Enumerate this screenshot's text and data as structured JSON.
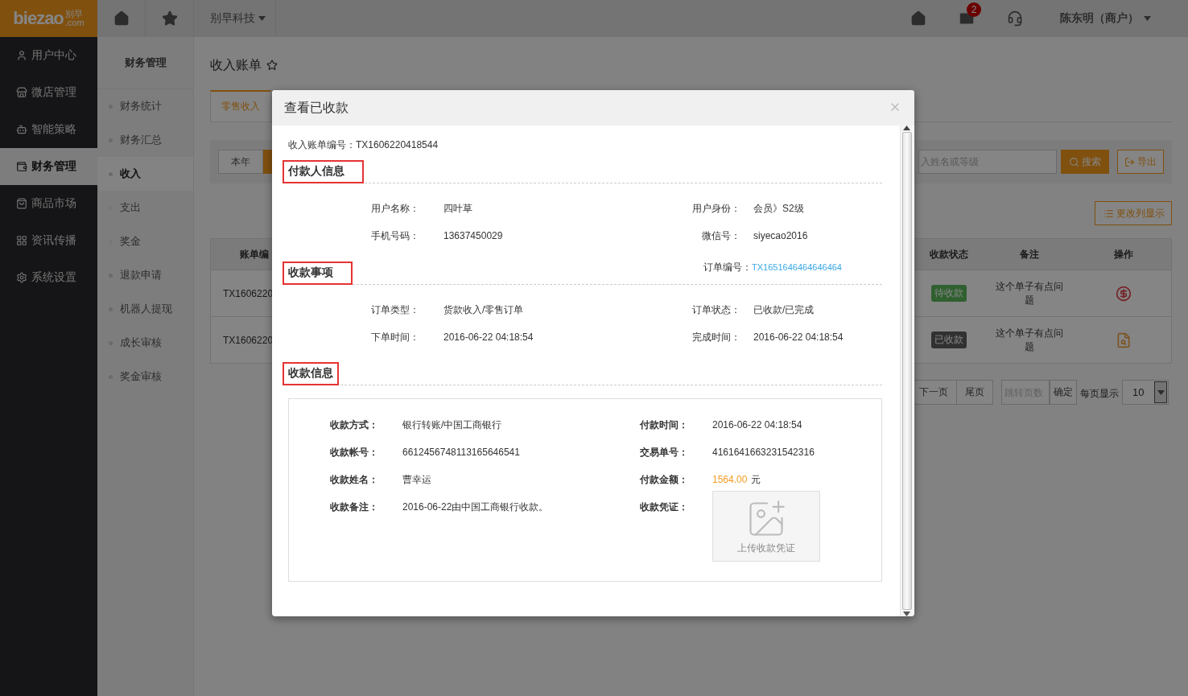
{
  "topbar": {
    "logo": {
      "word": "biezao",
      "cn": "别早",
      "domain": ".com"
    },
    "company": "别早科技",
    "mail_badge": "2",
    "user": "陈东明（商户）"
  },
  "sidebar": {
    "items": [
      {
        "label": "用户中心",
        "selected": false
      },
      {
        "label": "微店管理",
        "selected": false
      },
      {
        "label": "智能策略",
        "selected": false
      },
      {
        "label": "财务管理",
        "selected": true
      },
      {
        "label": "商品市场",
        "selected": false
      },
      {
        "label": "资讯传播",
        "selected": false
      },
      {
        "label": "系统设置",
        "selected": false
      }
    ]
  },
  "subnav": {
    "title": "财务管理",
    "items": [
      {
        "label": "财务统计",
        "kind": "dot",
        "selected": false
      },
      {
        "label": "财务汇总",
        "kind": "dot",
        "selected": false
      },
      {
        "label": "收入",
        "kind": "dot",
        "selected": true
      },
      {
        "label": "支出",
        "kind": "arrow",
        "selected": false
      },
      {
        "label": "奖金",
        "kind": "arrow",
        "selected": false
      },
      {
        "label": "退款申请",
        "kind": "dot",
        "selected": false
      },
      {
        "label": "机器人提现",
        "kind": "dot",
        "selected": false
      },
      {
        "label": "成长审核",
        "kind": "dot",
        "selected": false
      },
      {
        "label": "奖金审核",
        "kind": "dot",
        "selected": false
      }
    ]
  },
  "page": {
    "title": "收入账单",
    "tabs": [
      {
        "label": "零售收入",
        "selected": true
      }
    ],
    "filter": {
      "buttons": [
        {
          "label": "本年",
          "selected": false
        },
        {
          "selected": true
        }
      ],
      "search_placeholder": "入姓名或等级",
      "search_button": "搜索",
      "export_button": "导出"
    },
    "columns_button": "更改列显示",
    "table": {
      "columns": [
        "账单编",
        "收款状态",
        "备注",
        "操作"
      ],
      "rows": [
        {
          "bill": "TX1606220",
          "kind": "pending",
          "status": "待收款",
          "note": "这个单子有点问题"
        },
        {
          "bill": "TX1606220",
          "kind": "received",
          "status": "已收款",
          "note": "这个单子有点问题"
        }
      ]
    },
    "pagination": {
      "next": "下一页",
      "last": "尾页",
      "jump_placeholder": "跳转页数",
      "confirm": "确定",
      "per_page_label": "每页显示",
      "per_page": "10"
    }
  },
  "modal": {
    "title": "查看已收款",
    "bill_label": "收入账单编号：",
    "bill_no": "TX1606220418544",
    "payer": {
      "heading": "付款人信息",
      "fields": [
        {
          "label": "用户名称：",
          "value": "四叶草"
        },
        {
          "label": "用户身份：",
          "value": "会员》S2级"
        },
        {
          "label": "手机号码：",
          "value": "13637450029"
        },
        {
          "label": "微信号：",
          "value": "siyecao2016"
        }
      ]
    },
    "order": {
      "heading": "收款事项",
      "order_label": "订单编号：",
      "order_no": "TX1651646464646464",
      "fields": [
        {
          "label": "订单类型：",
          "value": "货款收入/零售订单"
        },
        {
          "label": "订单状态：",
          "value": "已收款/已完成"
        },
        {
          "label": "下单时间：",
          "value": "2016-06-22 04:18:54"
        },
        {
          "label": "完成时间：",
          "value": "2016-06-22 04:18:54"
        }
      ]
    },
    "receipt": {
      "heading": "收款信息",
      "fields": [
        {
          "kind": "text",
          "label": "收款方式：",
          "value": "银行转账/中国工商银行"
        },
        {
          "kind": "text",
          "label": "付款时间：",
          "value": "2016-06-22 04:18:54"
        },
        {
          "kind": "text",
          "label": "收款帐号：",
          "value": "6612456748113165646541"
        },
        {
          "kind": "text",
          "label": "交易单号：",
          "value": "4161641663231542316"
        },
        {
          "kind": "text",
          "label": "收款姓名：",
          "value": "曹幸运"
        },
        {
          "kind": "amount",
          "label": "付款金额：",
          "value": "1564.00",
          "unit": "元"
        },
        {
          "kind": "text",
          "label": "收款备注：",
          "value": "2016-06-22由中国工商银行收款。"
        },
        {
          "kind": "upload",
          "label": "收款凭证：",
          "value": "上传收款凭证"
        }
      ]
    }
  }
}
